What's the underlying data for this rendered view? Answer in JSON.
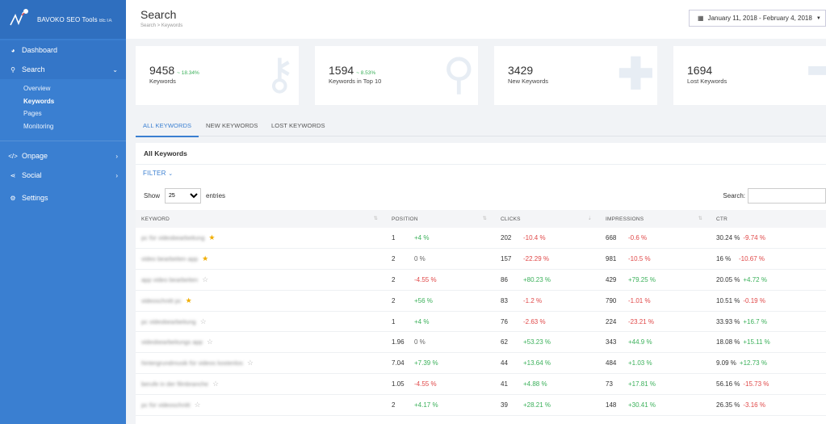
{
  "app": {
    "name": "BAVOKO SEO Tools",
    "beta": "BETA"
  },
  "nav": {
    "dashboard": "Dashboard",
    "search": "Search",
    "search_sub": [
      "Overview",
      "Keywords",
      "Pages",
      "Monitoring"
    ],
    "onpage": "Onpage",
    "social": "Social",
    "settings": "Settings"
  },
  "header": {
    "title": "Search",
    "breadcrumb": "Search > Keywords",
    "date_range": "January 11, 2018 - February 4, 2018"
  },
  "cards": [
    {
      "value": "9458",
      "delta": "~ 18.34%",
      "label": "Keywords",
      "icon": "key-icon"
    },
    {
      "value": "1594",
      "delta": "~ 8.53%",
      "label": "Keywords in Top 10",
      "icon": "magnifier-icon"
    },
    {
      "value": "3429",
      "delta": "",
      "label": "New Keywords",
      "icon": "plus-icon"
    },
    {
      "value": "1694",
      "delta": "",
      "label": "Lost Keywords",
      "icon": "minus-icon"
    }
  ],
  "tabs": [
    "ALL KEYWORDS",
    "NEW KEYWORDS",
    "LOST KEYWORDS"
  ],
  "panel": {
    "title": "All Keywords",
    "filter": "FILTER",
    "show_label": "Show",
    "entries_label": "entries",
    "show_value": "25",
    "search_label": "Search:"
  },
  "table": {
    "columns": [
      "KEYWORD",
      "POSITION",
      "CLICKS",
      "IMPRESSIONS",
      "CTR"
    ],
    "rows": [
      {
        "keyword": "pc für videobearbeitung",
        "star": true,
        "pos": "1",
        "pos_d": "+4 %",
        "pos_s": "pos",
        "clicks": "202",
        "clicks_d": "-10.4 %",
        "clicks_s": "neg",
        "imp": "668",
        "imp_d": "-0.6 %",
        "imp_s": "neg",
        "ctr": "30.24 %",
        "ctr_d": "-9.74 %",
        "ctr_s": "neg"
      },
      {
        "keyword": "video bearbeiten app",
        "star": true,
        "pos": "2",
        "pos_d": "0 %",
        "pos_s": "neu",
        "clicks": "157",
        "clicks_d": "-22.29 %",
        "clicks_s": "neg",
        "imp": "981",
        "imp_d": "-10.5 %",
        "imp_s": "neg",
        "ctr": "16 %",
        "ctr_d": "-10.67 %",
        "ctr_s": "neg"
      },
      {
        "keyword": "app video bearbeiten",
        "star": false,
        "pos": "2",
        "pos_d": "-4.55 %",
        "pos_s": "neg",
        "clicks": "86",
        "clicks_d": "+80.23 %",
        "clicks_s": "pos",
        "imp": "429",
        "imp_d": "+79.25 %",
        "imp_s": "pos",
        "ctr": "20.05 %",
        "ctr_d": "+4.72 %",
        "ctr_s": "pos"
      },
      {
        "keyword": "videoschnitt pc",
        "star": true,
        "pos": "2",
        "pos_d": "+56 %",
        "pos_s": "pos",
        "clicks": "83",
        "clicks_d": "-1.2 %",
        "clicks_s": "neg",
        "imp": "790",
        "imp_d": "-1.01 %",
        "imp_s": "neg",
        "ctr": "10.51 %",
        "ctr_d": "-0.19 %",
        "ctr_s": "neg"
      },
      {
        "keyword": "pc videobearbeitung",
        "star": false,
        "pos": "1",
        "pos_d": "+4 %",
        "pos_s": "pos",
        "clicks": "76",
        "clicks_d": "-2.63 %",
        "clicks_s": "neg",
        "imp": "224",
        "imp_d": "-23.21 %",
        "imp_s": "neg",
        "ctr": "33.93 %",
        "ctr_d": "+16.7 %",
        "ctr_s": "pos"
      },
      {
        "keyword": "videobearbeitungs app",
        "star": false,
        "pos": "1.96",
        "pos_d": "0 %",
        "pos_s": "neu",
        "clicks": "62",
        "clicks_d": "+53.23 %",
        "clicks_s": "pos",
        "imp": "343",
        "imp_d": "+44.9 %",
        "imp_s": "pos",
        "ctr": "18.08 %",
        "ctr_d": "+15.11 %",
        "ctr_s": "pos"
      },
      {
        "keyword": "hintergrundmusik für videos kostenlos",
        "star": false,
        "pos": "7.04",
        "pos_d": "+7.39 %",
        "pos_s": "pos",
        "clicks": "44",
        "clicks_d": "+13.64 %",
        "clicks_s": "pos",
        "imp": "484",
        "imp_d": "+1.03 %",
        "imp_s": "pos",
        "ctr": "9.09 %",
        "ctr_d": "+12.73 %",
        "ctr_s": "pos"
      },
      {
        "keyword": "berufe in der filmbranche",
        "star": false,
        "pos": "1.05",
        "pos_d": "-4.55 %",
        "pos_s": "neg",
        "clicks": "41",
        "clicks_d": "+4.88 %",
        "clicks_s": "pos",
        "imp": "73",
        "imp_d": "+17.81 %",
        "imp_s": "pos",
        "ctr": "56.16 %",
        "ctr_d": "-15.73 %",
        "ctr_s": "neg"
      },
      {
        "keyword": "pc für videoschnitt",
        "star": false,
        "pos": "2",
        "pos_d": "+4.17 %",
        "pos_s": "pos",
        "clicks": "39",
        "clicks_d": "+28.21 %",
        "clicks_s": "pos",
        "imp": "148",
        "imp_d": "+30.41 %",
        "imp_s": "pos",
        "ctr": "26.35 %",
        "ctr_d": "-3.16 %",
        "ctr_s": "neg"
      }
    ]
  },
  "colors": {
    "sidebar": "#3a7fd1",
    "accent": "#3a7fd1",
    "positive": "#3bb05a",
    "negative": "#e04848",
    "star": "#f0ad00"
  }
}
